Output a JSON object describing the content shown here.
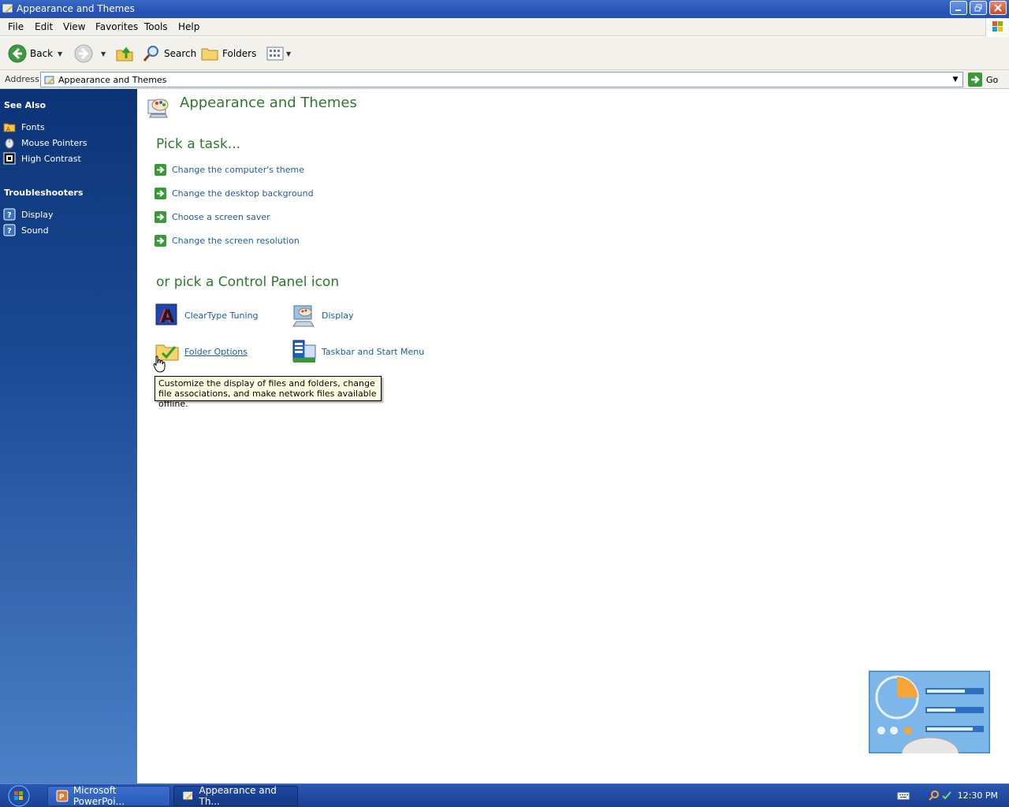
{
  "window": {
    "title": "Appearance and Themes"
  },
  "menu": {
    "items": [
      "File",
      "Edit",
      "View",
      "Favorites",
      "Tools",
      "Help"
    ]
  },
  "toolbar": {
    "back_label": "Back",
    "search_label": "Search",
    "folders_label": "Folders"
  },
  "address": {
    "label": "Address",
    "value": "Appearance and Themes",
    "go_label": "Go"
  },
  "sidebar": {
    "see_also": {
      "heading": "See Also",
      "items": [
        {
          "label": "Fonts",
          "icon": "fonts-folder-icon"
        },
        {
          "label": "Mouse Pointers",
          "icon": "mouse-icon"
        },
        {
          "label": "High Contrast",
          "icon": "high-contrast-icon"
        }
      ]
    },
    "troubleshooters": {
      "heading": "Troubleshooters",
      "items": [
        {
          "label": "Display",
          "icon": "help-icon"
        },
        {
          "label": "Sound",
          "icon": "help-icon"
        }
      ]
    }
  },
  "main": {
    "title": "Appearance and Themes",
    "pick_task": {
      "heading": "Pick a task...",
      "tasks": [
        "Change the computer's theme",
        "Change the desktop background",
        "Choose a screen saver",
        "Change the screen resolution"
      ]
    },
    "pick_icon": {
      "heading": "or pick a Control Panel icon",
      "icons": [
        {
          "label": "ClearType Tuning",
          "icon": "cleartype-icon"
        },
        {
          "label": "Display",
          "icon": "display-icon"
        },
        {
          "label": "Folder Options",
          "icon": "folder-options-icon"
        },
        {
          "label": "Taskbar and Start Menu",
          "icon": "taskbar-icon"
        }
      ]
    },
    "tooltip": "Customize the display of files and folders, change file associations, and make network files available offline."
  },
  "taskbar": {
    "buttons": [
      {
        "label": "Microsoft PowerPoi...",
        "active": false
      },
      {
        "label": "Appearance and Th...",
        "active": true
      }
    ],
    "clock": "12:30 PM"
  },
  "colors": {
    "title_bar": "#2a57b8",
    "sidebar_top": "#0d3377",
    "heading_green": "#2b7a2b",
    "link_blue": "#1f5b99",
    "tooltip_bg": "#ffffe1"
  }
}
